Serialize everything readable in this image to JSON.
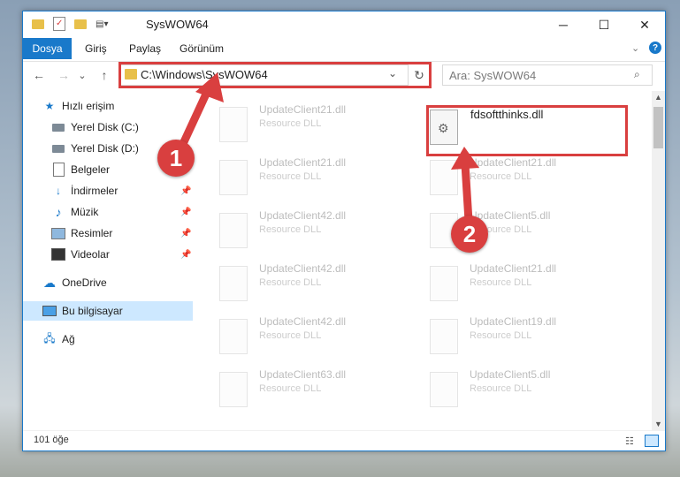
{
  "window": {
    "title": "SysWOW64"
  },
  "controls": {
    "minimize": "─",
    "maximize": "☐",
    "close": "✕"
  },
  "ribbon": {
    "tabs": [
      "Dosya",
      "Giriş",
      "Paylaş",
      "Görünüm"
    ]
  },
  "nav": {
    "back": "←",
    "forward": "→",
    "recent": "⌄",
    "up": "↑"
  },
  "address": {
    "path": "C:\\Windows\\SysWOW64"
  },
  "search": {
    "placeholder": "Ara: SysWOW64"
  },
  "sidebar": {
    "items": [
      {
        "label": "Hızlı erişim",
        "icon": "star-icon",
        "pinned": false
      },
      {
        "label": "Yerel Disk (C:)",
        "icon": "drive-icon",
        "pinned": false
      },
      {
        "label": "Yerel Disk (D:)",
        "icon": "drive-icon",
        "pinned": false
      },
      {
        "label": "Belgeler",
        "icon": "document-icon",
        "pinned": true
      },
      {
        "label": "İndirmeler",
        "icon": "download-icon",
        "pinned": true
      },
      {
        "label": "Müzik",
        "icon": "music-icon",
        "pinned": true
      },
      {
        "label": "Resimler",
        "icon": "picture-icon",
        "pinned": true
      },
      {
        "label": "Videolar",
        "icon": "video-icon",
        "pinned": true
      },
      {
        "label": "OneDrive",
        "icon": "cloud-icon",
        "pinned": false
      },
      {
        "label": "Bu bilgisayar",
        "icon": "computer-icon",
        "pinned": false
      },
      {
        "label": "Ağ",
        "icon": "network-icon",
        "pinned": false
      }
    ]
  },
  "files": {
    "highlighted": {
      "name": "fdsoftthinks.dll"
    },
    "left_column": [
      {
        "name": "UpdateClient21.dll",
        "type": "Resource DLL"
      },
      {
        "name": "UpdateClient21.dll",
        "type": "Resource DLL"
      },
      {
        "name": "UpdateClient42.dll",
        "type": "Resource DLL"
      },
      {
        "name": "UpdateClient42.dll",
        "type": "Resource DLL"
      },
      {
        "name": "UpdateClient42.dll",
        "type": "Resource DLL"
      },
      {
        "name": "UpdateClient63.dll",
        "type": "Resource DLL"
      }
    ],
    "right_column": [
      {
        "name": "UpdateClient21.dll",
        "type": "Resource DLL"
      },
      {
        "name": "UpdateClient5.dll",
        "type": "Resource DLL"
      },
      {
        "name": "UpdateClient21.dll",
        "type": "Resource DLL"
      },
      {
        "name": "UpdateClient19.dll",
        "type": "Resource DLL"
      },
      {
        "name": "UpdateClient5.dll",
        "type": "Resource DLL"
      }
    ]
  },
  "status": {
    "count": "101 öğe"
  },
  "annotations": {
    "step1": "1",
    "step2": "2"
  },
  "colors": {
    "accent": "#1979ca",
    "highlight": "#d93f3f"
  }
}
